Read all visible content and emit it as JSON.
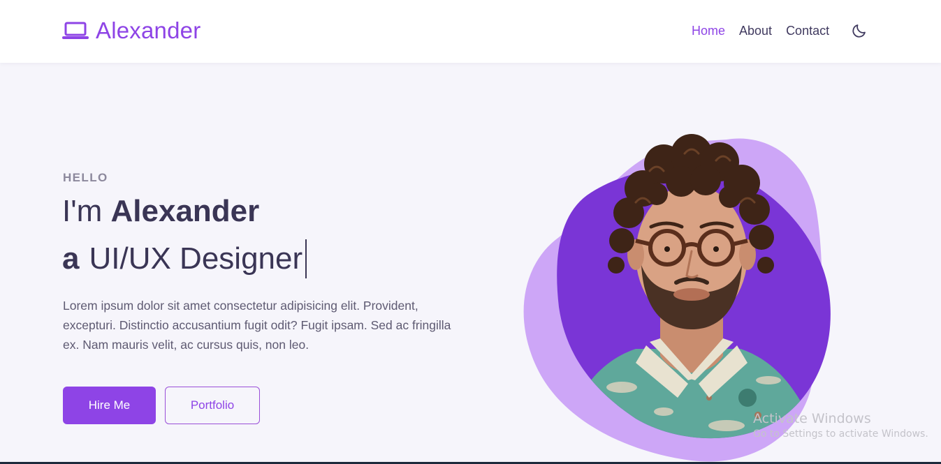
{
  "header": {
    "brand_icon": "laptop-icon",
    "brand_name": "Alexander",
    "nav": [
      {
        "label": "Home",
        "active": true
      },
      {
        "label": "About",
        "active": false
      },
      {
        "label": "Contact",
        "active": false
      }
    ],
    "theme_icon": "moon-icon"
  },
  "hero": {
    "greeting": "HELLO",
    "line1_prefix": "I'm",
    "line1_name": "Alexander",
    "line2_prefix": "a",
    "line2_role": "UI/UX Designer",
    "description": "Lorem ipsum dolor sit amet consectetur adipisicing elit. Provident, excepturi. Distinctio accusantium fugit odit? Fugit ipsam. Sed ac fringilla ex. Nam mauris velit, ac cursus quis, non leo.",
    "hire_label": "Hire Me",
    "portfolio_label": "Portfolio",
    "portrait_icon": "portrait-photo"
  },
  "watermark": {
    "title": "Activate Windows",
    "subtitle": "Go to Settings to activate Windows."
  },
  "colors": {
    "accent": "#8e44e6",
    "blob_light": "#cda6f7",
    "blob_dark": "#7a35d6",
    "text_dark": "#3a3555",
    "background": "#f6f5fb"
  }
}
